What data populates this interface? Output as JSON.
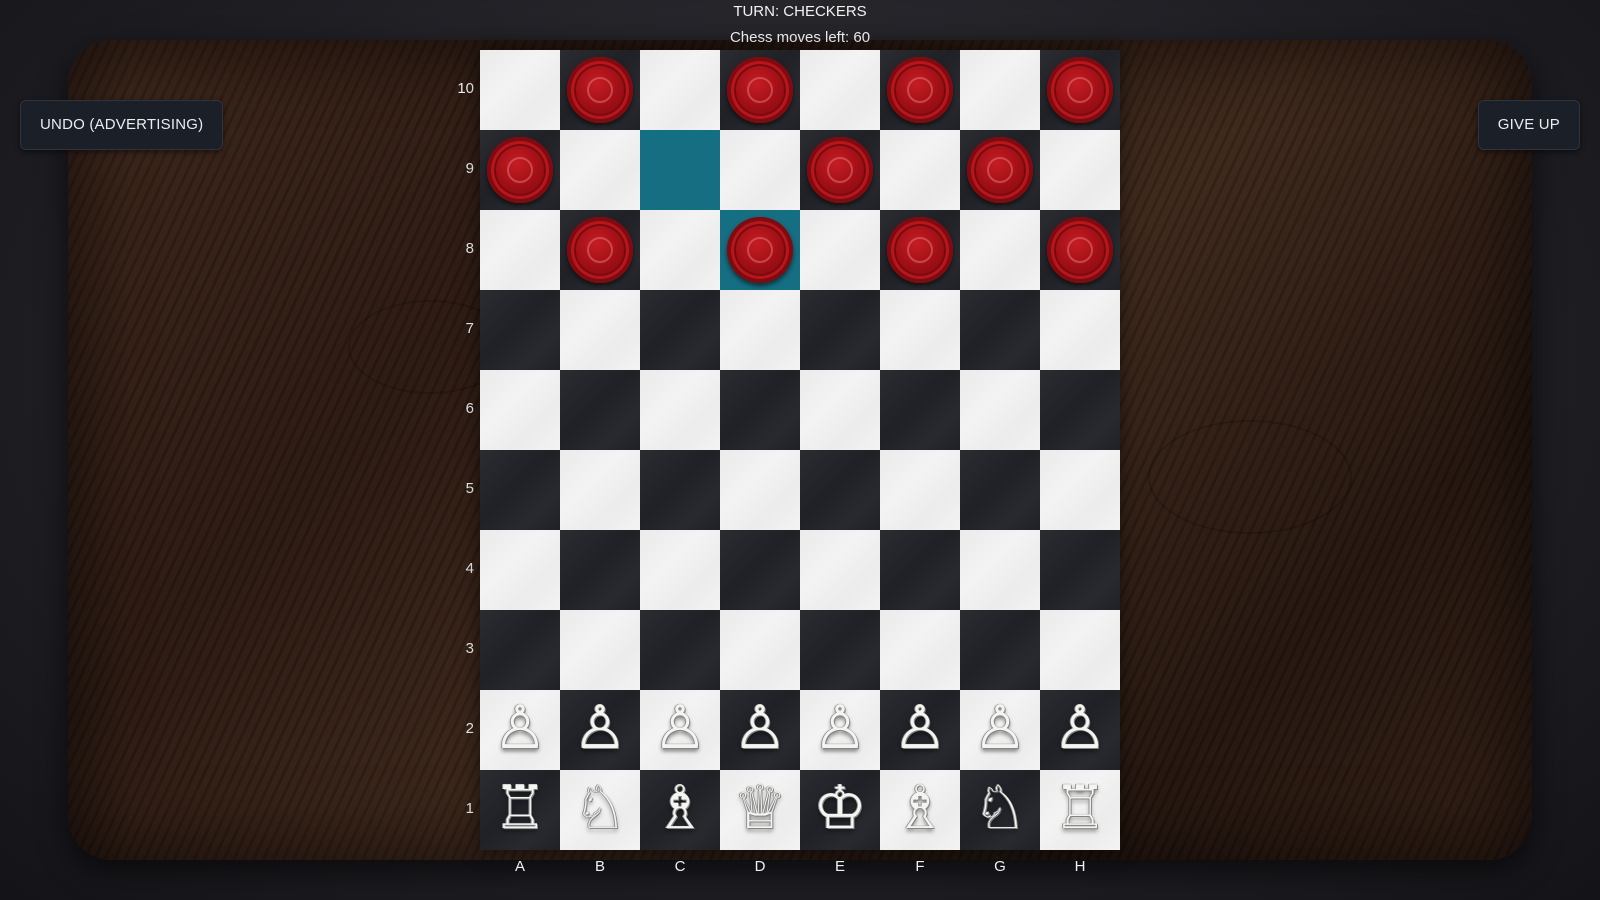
{
  "hud": {
    "turn": "TURN: CHECKERS",
    "moves_left": "Chess moves left: 60"
  },
  "buttons": {
    "undo": "UNDO (ADVERTISING)",
    "give_up": "GIVE UP"
  },
  "colors": {
    "highlight": "#156e82",
    "checker_red": "#9e0f14",
    "light_square": "#f3f3f3",
    "dark_square": "#1f2126"
  },
  "board": {
    "files": [
      "A",
      "B",
      "C",
      "D",
      "E",
      "F",
      "G",
      "H"
    ],
    "ranks": [
      "10",
      "9",
      "8",
      "7",
      "6",
      "5",
      "4",
      "3",
      "2",
      "1"
    ],
    "highlighted": [
      "C9",
      "D8"
    ],
    "checkers": [
      "B10",
      "D10",
      "F10",
      "H10",
      "A9",
      "E9",
      "G9",
      "B8",
      "D8",
      "F8",
      "H8"
    ],
    "chess_pieces": {
      "A1": "rook",
      "B1": "knight",
      "C1": "bishop",
      "D1": "queen",
      "E1": "king",
      "F1": "bishop",
      "G1": "knight",
      "H1": "rook",
      "A2": "pawn",
      "B2": "pawn",
      "C2": "pawn",
      "D2": "pawn",
      "E2": "pawn",
      "F2": "pawn",
      "G2": "pawn",
      "H2": "pawn"
    }
  }
}
